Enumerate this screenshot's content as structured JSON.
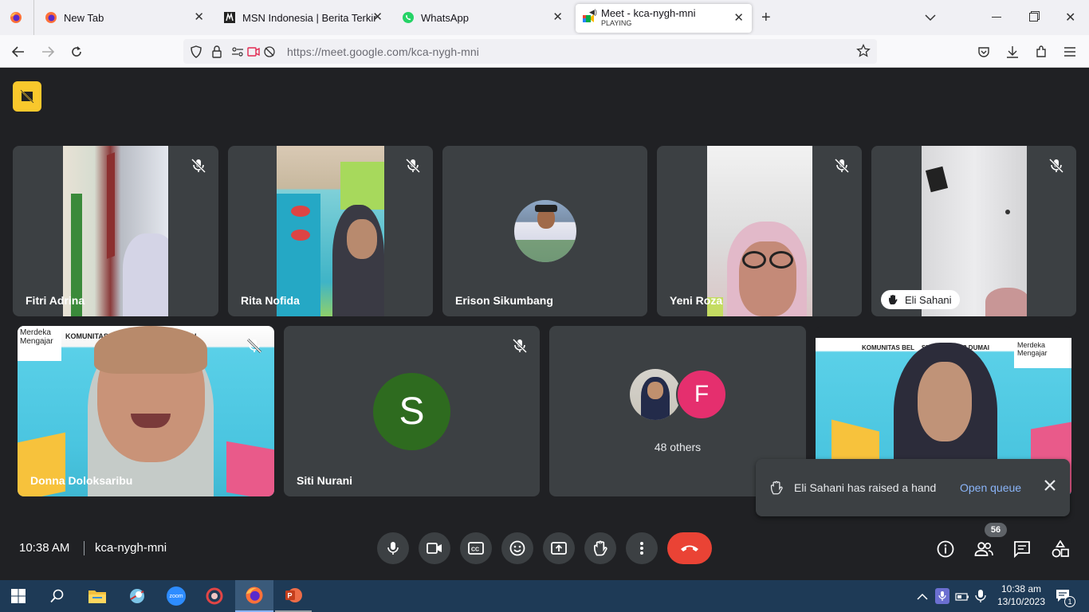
{
  "browser": {
    "tabs": [
      {
        "title": "New Tab"
      },
      {
        "title": "MSN Indonesia | Berita Terkini H"
      },
      {
        "title": "WhatsApp"
      },
      {
        "title": "Meet - kca-nygh-mni",
        "status": "PLAYING"
      }
    ],
    "url_host": "https://meet.google.com",
    "url_path": "/kca-nygh-mni"
  },
  "participants": {
    "row1": [
      {
        "name": "Fitri Adrina"
      },
      {
        "name": "Rita Nofida"
      },
      {
        "name": "Erison Sikumbang"
      },
      {
        "name": "Yeni Roza"
      },
      {
        "name": "Eli Sahani"
      }
    ],
    "row2": [
      {
        "name": "Donna Doloksaribu",
        "banner_left": "Merdeka\nMengajar",
        "banner_text": "KOMUNITAS BELA    NEGERI 3 DUMAI"
      },
      {
        "name": "Siti Nurani",
        "initial": "S"
      },
      {
        "others_label": "48 others",
        "initial": "F"
      },
      {
        "banner_text": "KOMUNITAS BEL    SMP NEGERI 3 DUMAI",
        "banner_right": "Merdeka\nMengajar"
      }
    ]
  },
  "toast": {
    "message": "Eli Sahani has raised a hand",
    "action": "Open queue"
  },
  "bottom": {
    "time": "10:38 AM",
    "meeting_code": "kca-nygh-mni",
    "people_count": "56"
  },
  "taskbar": {
    "time": "10:38 am",
    "date": "13/10/2023",
    "notifications": "1",
    "zoom_label": "zoom"
  },
  "colors": {
    "meet_bg": "#202124",
    "tile_bg": "#3c4043",
    "end_call": "#ea4335",
    "accent_blue": "#8ab4f8",
    "avatar_green": "#2e6b1f",
    "avatar_pink": "#e52f6e",
    "yellow_badge": "#f9c82c"
  }
}
